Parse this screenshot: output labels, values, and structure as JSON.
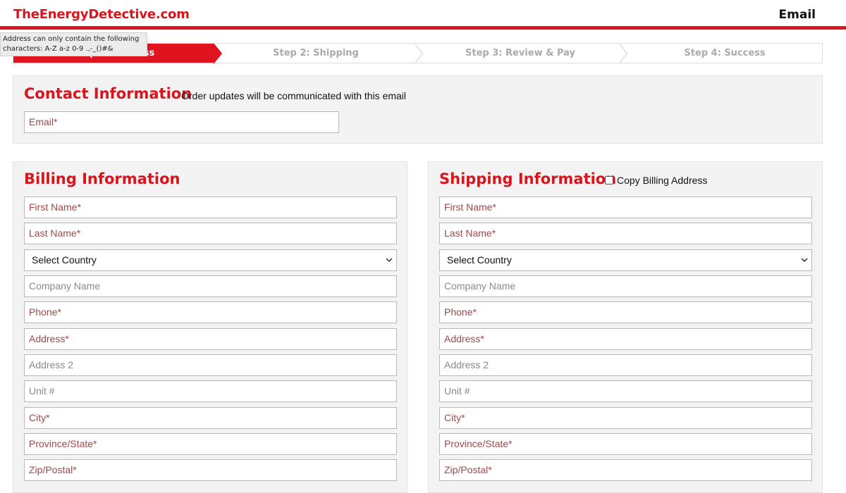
{
  "header": {
    "logo": "TheEnergyDetective.com",
    "email_link": "Email"
  },
  "tooltip": {
    "text": "Address can only contain the following characters: A-Z a-z 0-9 .,-_()#&"
  },
  "steps": [
    {
      "label": "Step 1: Address",
      "active": true
    },
    {
      "label": "Step 2: Shipping",
      "active": false
    },
    {
      "label": "Step 3: Review & Pay",
      "active": false
    },
    {
      "label": "Step 4: Success",
      "active": false
    }
  ],
  "contact": {
    "title": "Contact Information",
    "subtitle": "Order updates will be communicated with this email",
    "email_placeholder": "Email*"
  },
  "billing": {
    "title": "Billing Information",
    "first_name": "First Name*",
    "last_name": "Last Name*",
    "country": "Select Country",
    "company": "Company Name",
    "phone": "Phone*",
    "address": "Address*",
    "address2": "Address 2",
    "unit": "Unit #",
    "city": "City*",
    "province": "Province/State*",
    "zip": "Zip/Postal*"
  },
  "shipping": {
    "title": "Shipping Information",
    "copy_label": "Copy Billing Address",
    "copy_checked": false,
    "first_name": "First Name*",
    "last_name": "Last Name*",
    "country": "Select Country",
    "company": "Company Name",
    "phone": "Phone*",
    "address": "Address*",
    "address2": "Address 2",
    "unit": "Unit #",
    "city": "City*",
    "province": "Province/State*",
    "zip": "Zip/Postal*"
  },
  "colors": {
    "brand_red": "#e0141e",
    "panel_bg": "#f4f3f3",
    "placeholder_required": "#9b4b4b",
    "placeholder_optional": "#8a8a8a"
  }
}
